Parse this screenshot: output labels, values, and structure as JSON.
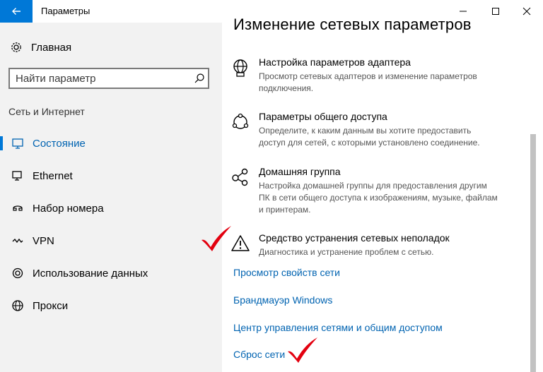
{
  "window": {
    "title": "Параметры"
  },
  "sidebar": {
    "home_label": "Главная",
    "search_placeholder": "Найти параметр",
    "section_title": "Сеть и Интернет",
    "items": [
      {
        "label": "Состояние",
        "icon": "status-icon",
        "active": true
      },
      {
        "label": "Ethernet",
        "icon": "ethernet-icon",
        "active": false
      },
      {
        "label": "Набор номера",
        "icon": "dialup-icon",
        "active": false
      },
      {
        "label": "VPN",
        "icon": "vpn-icon",
        "active": false
      },
      {
        "label": "Использование данных",
        "icon": "data-usage-icon",
        "active": false
      },
      {
        "label": "Прокси",
        "icon": "globe-icon",
        "active": false
      }
    ]
  },
  "main": {
    "heading": "Изменение сетевых параметров",
    "options": [
      {
        "title": "Настройка параметров адаптера",
        "desc": "Просмотр сетевых адаптеров и изменение параметров подключения.",
        "icon": "adapter-icon"
      },
      {
        "title": "Параметры общего доступа",
        "desc": "Определите, к каким данным вы хотите предоставить доступ для сетей, с которыми установлено соединение.",
        "icon": "sharing-icon"
      },
      {
        "title": "Домашняя группа",
        "desc": "Настройка домашней группы для предоставления другим ПК в сети общего доступа к изображениям, музыке, файлам и принтерам.",
        "icon": "homegroup-icon"
      },
      {
        "title": "Средство устранения сетевых неполадок",
        "desc": "Диагностика и устранение проблем с сетью.",
        "icon": "warning-icon"
      }
    ],
    "links": [
      "Просмотр свойств сети",
      "Брандмауэр Windows",
      "Центр управления сетями и общим доступом",
      "Сброс сети"
    ]
  },
  "colors": {
    "accent": "#0078d7",
    "link": "#0063b1",
    "checkmark": "#e3000f",
    "sidebar_bg": "#f2f2f2"
  }
}
